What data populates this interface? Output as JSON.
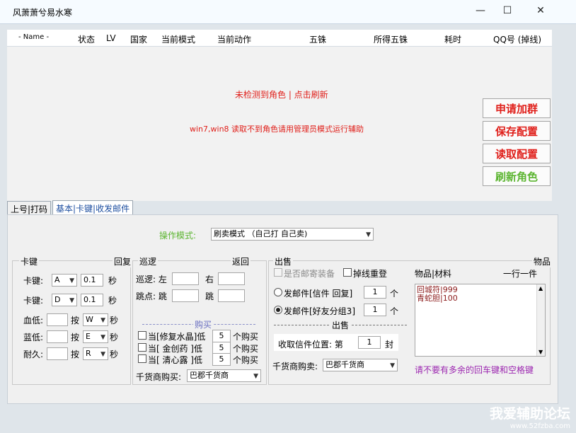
{
  "window": {
    "title": "风萧萧兮易水寒"
  },
  "columns": [
    "- Name -",
    "状态",
    "LV",
    "国家",
    "当前模式",
    "当前动作",
    "五铢",
    "所得五铢",
    "耗时",
    "QQ号 (掉线)"
  ],
  "list_messages": {
    "line1": "未检测到角色 | 点击刷新",
    "line2": "win7,win8 读取不到角色请用管理员模式运行辅助"
  },
  "side_buttons": {
    "join_group": "申请加群",
    "save_config": "保存配置",
    "read_config": "读取配置",
    "refresh_role": "刷新角色"
  },
  "tabs": {
    "tab1": "上号|打码",
    "tab2": "基本|卡键|收发邮件"
  },
  "mode": {
    "label": "操作模式:",
    "value": "刷卖模式 （自己打 自己卖)"
  },
  "kajian": {
    "title_left": "卡键",
    "title_right": "回复",
    "row1": {
      "label": "卡键:",
      "key": "A",
      "value": "0.1",
      "unit": "秒"
    },
    "row2": {
      "label": "卡键:",
      "key": "D",
      "value": "0.1",
      "unit": "秒"
    },
    "hp": {
      "label": "血低:",
      "value": "",
      "press": "按",
      "key": "W",
      "unit": "秒"
    },
    "mp": {
      "label": "蓝低:",
      "value": "",
      "press": "按",
      "key": "E",
      "unit": "秒"
    },
    "dur": {
      "label": "耐久:",
      "value": "",
      "press": "按",
      "key": "R",
      "unit": "秒"
    }
  },
  "patrol": {
    "title_left": "巡逻",
    "title_right": "返回",
    "row1": {
      "label": "巡逻: 左",
      "right": "右"
    },
    "row2": {
      "label": "跳点: 跳",
      "right": "跳"
    },
    "buy_title": "购买",
    "buy1": {
      "prefix": "当[修复水晶]低",
      "value": "5",
      "suffix": "个购买"
    },
    "buy2": {
      "prefix": "当[ 金创药 ]低",
      "value": "5",
      "suffix": "个购买"
    },
    "buy3": {
      "prefix": "当[ 清心露 ]低",
      "value": "5",
      "suffix": "个购买"
    },
    "merchant_label": "千货商购买:",
    "merchant_value": "巴郡千货商"
  },
  "sell": {
    "title": "出售",
    "items_title": "物品",
    "mail_equip": "是否邮寄装备",
    "relogin": "掉线重登",
    "opt1": {
      "label": "发邮件[信件 回复]",
      "value": "1",
      "unit": "个"
    },
    "opt2": {
      "label": "发邮件[好友分组3]",
      "value": "1",
      "unit": "个"
    },
    "sub_title": "出售",
    "recv_label": "收取信件位置: 第",
    "recv_value": "1",
    "recv_unit": "封",
    "merchant_label": "千货商购卖:",
    "merchant_value": "巴郡千货商",
    "list_header_left": "物品|材料",
    "list_header_right": "一行一件",
    "items": [
      {
        "name": "回城符",
        "count": "999"
      },
      {
        "name": "青蛇胆",
        "count": "100"
      }
    ],
    "note": "请不要有多余的回车键和空格键"
  },
  "watermark": {
    "line1": "我爱辅助论坛",
    "line2": "www.52fzba.com"
  },
  "colors": {
    "red": "#e0201b",
    "green": "#5cb531",
    "purple": "#9c27b0",
    "link_blue": "#1e4fa0"
  }
}
